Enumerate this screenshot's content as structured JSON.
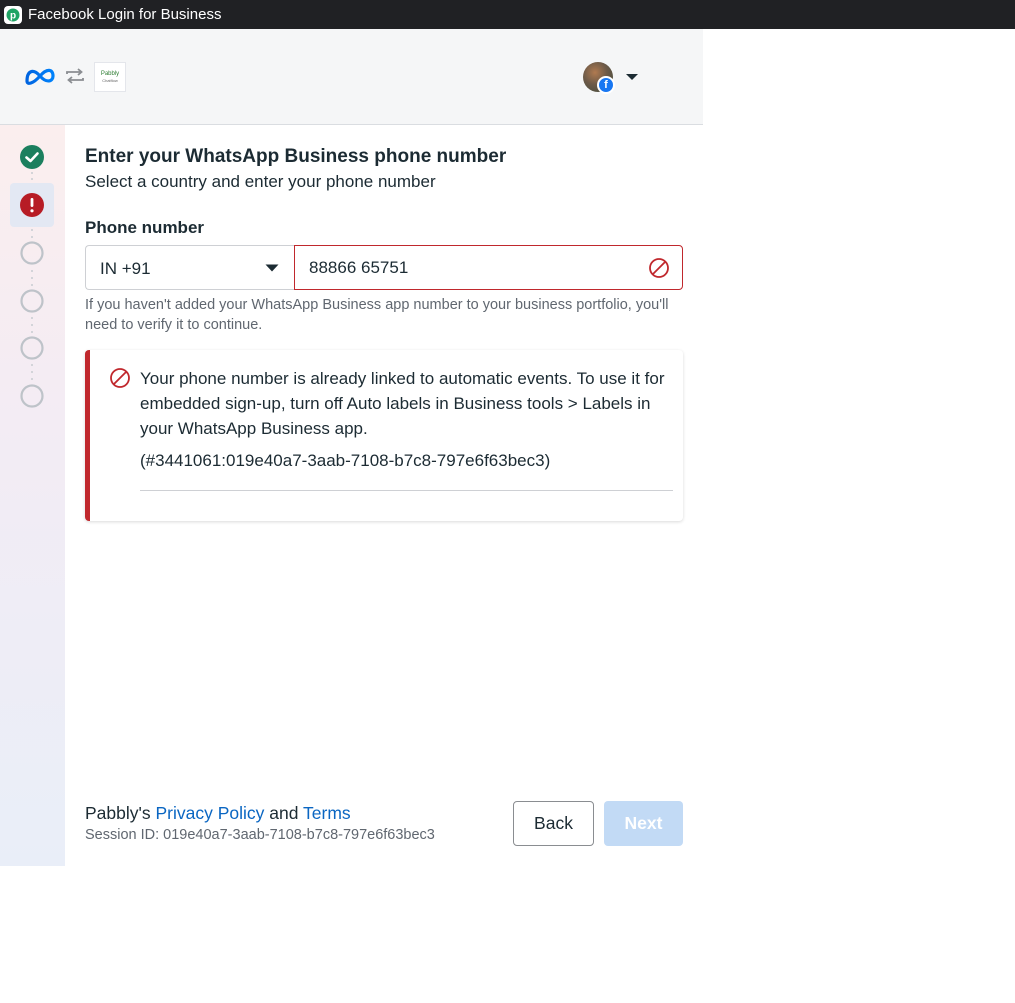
{
  "window": {
    "title": "Facebook Login for Business",
    "app_icon": "pabbly-p-icon"
  },
  "header": {
    "brand_icon": "meta-logo",
    "connect_icon": "sync-arrows-icon",
    "partner_logo_text": "Pabbly",
    "partner_logo_subtext": "Chatflow",
    "account_badge_glyph": "f",
    "account_menu_icon": "caret-down-icon"
  },
  "stepper": {
    "steps": [
      {
        "state": "complete",
        "glyph": "✓"
      },
      {
        "state": "error",
        "glyph": "!"
      },
      {
        "state": "pending"
      },
      {
        "state": "pending"
      },
      {
        "state": "pending"
      },
      {
        "state": "pending"
      }
    ],
    "colors": {
      "complete": "#1b7f5e",
      "error": "#b71c25",
      "pending": "#bec3c9"
    }
  },
  "form": {
    "heading": "Enter your WhatsApp Business phone number",
    "subheading": "Select a country and enter your phone number",
    "phone_label": "Phone number",
    "country_value": "IN +91",
    "phone_value": "88866 65751",
    "helper_text": "If you haven't added your WhatsApp Business app number to your business portfolio, you'll need to verify it to continue."
  },
  "error": {
    "message": "Your phone number is already linked to automatic events. To use it for embedded sign-up, turn off Auto labels in Business tools > Labels in your WhatsApp Business app.",
    "code": "(#3441061:019e40a7-3aab-7108-b7c8-797e6f63bec3)",
    "color": "#c0282d"
  },
  "footer": {
    "owner": "Pabbly's",
    "privacy_label": "Privacy Policy",
    "and": "and",
    "terms_label": "Terms",
    "session_id": "Session ID: 019e40a7-3aab-7108-b7c8-797e6f63bec3",
    "back_label": "Back",
    "next_label": "Next"
  }
}
